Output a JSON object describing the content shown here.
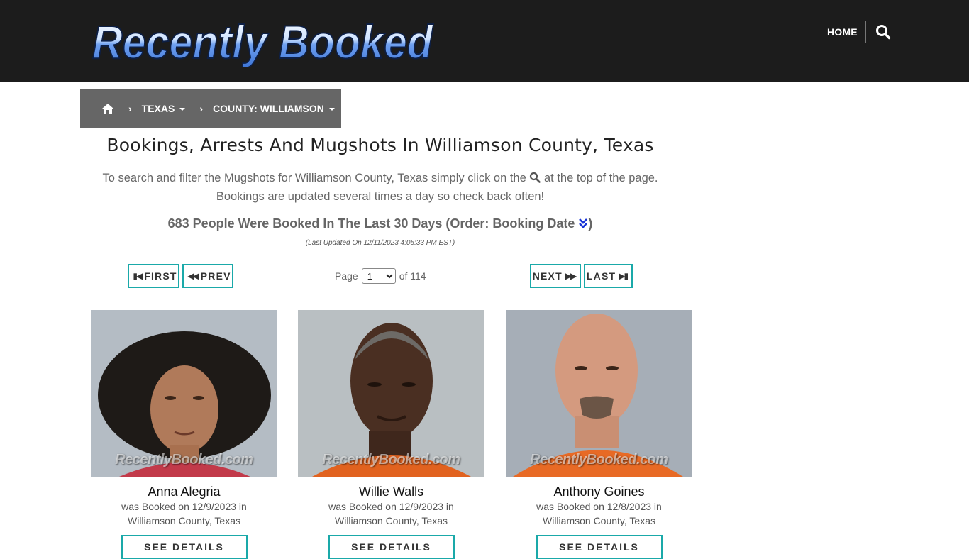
{
  "header": {
    "logo_text": "Recently Booked",
    "nav_home": "HOME",
    "search_icon": "search-icon"
  },
  "breadcrumb": {
    "home_icon": "home-icon",
    "state": "TEXAS",
    "county": "COUNTY: WILLIAMSON"
  },
  "title": "Bookings, Arrests And Mugshots In Williamson County, Texas",
  "intro": {
    "line1_before": "To search and filter the Mugshots for Williamson County, Texas simply click on the",
    "line1_after": "at the top of the page.",
    "line2": "Bookings are updated several times a day so check back often!"
  },
  "summary": {
    "count_text": "683 People Were Booked In The Last 30 Days (Order: Booking Date",
    "close_paren": ")",
    "order_icon": "double-chevron-down-icon",
    "updated": "(Last Updated On 12/11/2023 4:05:33 PM EST)"
  },
  "pager": {
    "first": "FIRST",
    "prev": "PREV",
    "next": "NEXT",
    "last": "LAST",
    "page_label": "Page",
    "current_page": "1",
    "of_label": "of 114"
  },
  "bookings": [
    {
      "name": "Anna Alegria",
      "booked": "was Booked on 12/9/2023 in",
      "location": "Williamson County, Texas",
      "button": "SEE DETAILS",
      "watermark": "RecentlyBooked.com"
    },
    {
      "name": "Willie Walls",
      "booked": "was Booked on 12/9/2023 in",
      "location": "Williamson County, Texas",
      "button": "SEE DETAILS",
      "watermark": "RecentlyBooked.com"
    },
    {
      "name": "Anthony Goines",
      "booked": "was Booked on 12/8/2023 in",
      "location": "Williamson County, Texas",
      "button": "SEE DETAILS",
      "watermark": "RecentlyBooked.com"
    }
  ],
  "colors": {
    "header_bg": "#1c1c1c",
    "breadcrumb_bg": "#666666",
    "accent_teal": "#1aa9a9"
  }
}
